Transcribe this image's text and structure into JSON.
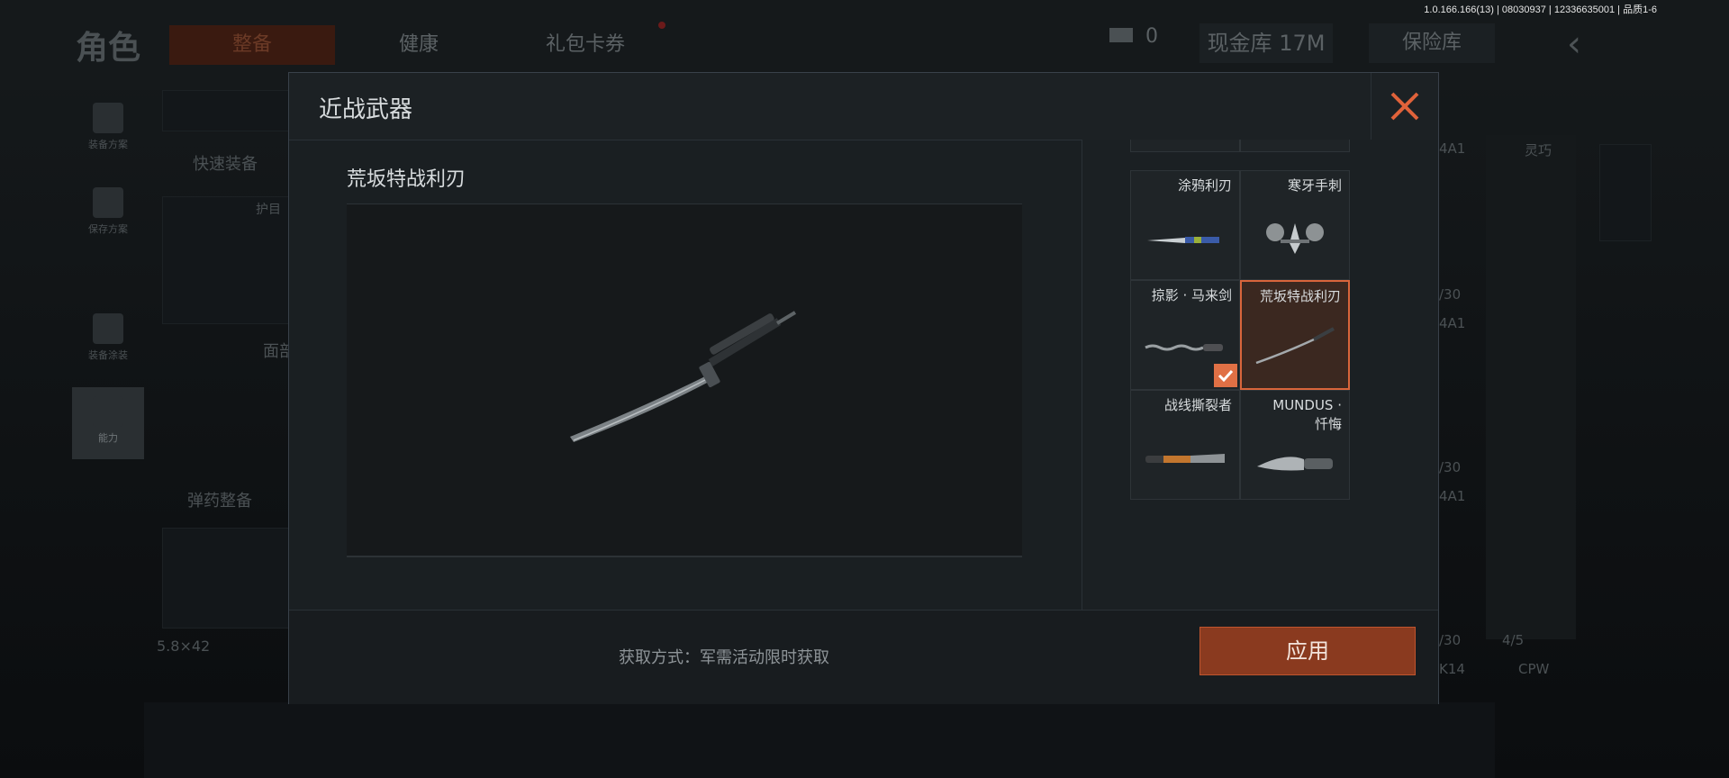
{
  "version_text": "1.0.166.166(13) | 08030937 | 12336635001 | 品质1-6",
  "background": {
    "title": "角色",
    "tabs": [
      "整备",
      "健康",
      "礼包卡券"
    ],
    "coin_value": "0",
    "cash": "现金库 17M",
    "vault": "保险库",
    "side_items": [
      "装备方案",
      "保存方案",
      "装备涂装",
      "能力"
    ],
    "quick_equip": "快速装备",
    "ammo_equip": "弹药整备",
    "ammo_caliber": "5.8×42",
    "face_label": "面部",
    "helmet_label": "护目",
    "right_labels": [
      "4A1",
      "灵巧",
      "/30",
      "4A1",
      "/30",
      "4A1",
      "/30",
      "4/5",
      "K14",
      "CPW"
    ]
  },
  "modal": {
    "title": "近战武器",
    "selected_name": "荒坂特战利刃",
    "acquire_text": "获取方式：军需活动限时获取",
    "apply_label": "应用",
    "weapons": [
      {
        "name": "涂鸦利刃",
        "selected": false,
        "equipped": false
      },
      {
        "name": "寒牙手刺",
        "selected": false,
        "equipped": false
      },
      {
        "name": "掠影 · 马来剑",
        "selected": false,
        "equipped": true
      },
      {
        "name": "荒坂特战利刃",
        "selected": true,
        "equipped": false
      },
      {
        "name": "战线撕裂者",
        "selected": false,
        "equipped": false
      },
      {
        "name_line1": "MUNDUS ·",
        "name_line2": "忏悔",
        "selected": false,
        "equipped": false
      }
    ]
  },
  "colors": {
    "accent": "#e0623a",
    "apply_bg": "#8a3a1f",
    "selected_card_bg": "#3b2820"
  },
  "icons": [
    "close-icon",
    "check-icon"
  ]
}
